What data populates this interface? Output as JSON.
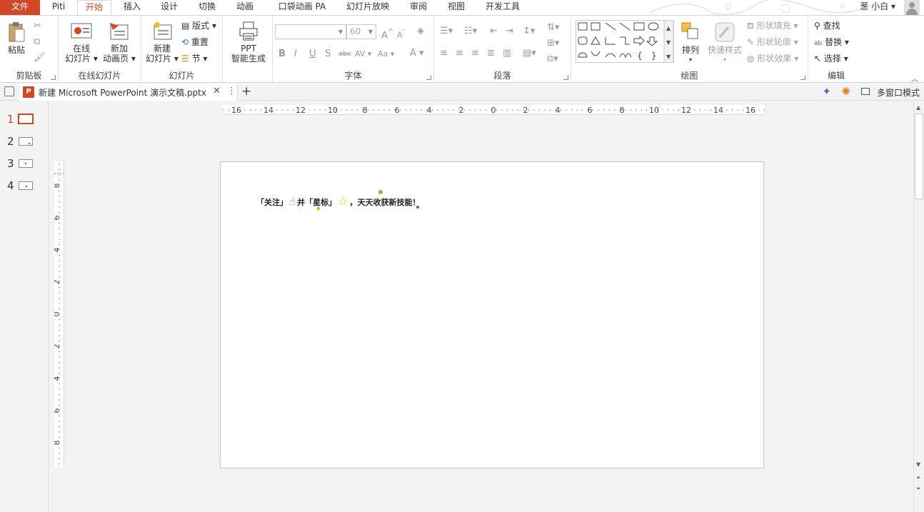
{
  "tabs": {
    "file": "文件",
    "items": [
      "Piti",
      "开始",
      "插入",
      "设计",
      "切换",
      "动画",
      "口袋动画 PA",
      "幻灯片放映",
      "审阅",
      "视图",
      "开发工具"
    ],
    "active_index": 1,
    "user": "葱 小白"
  },
  "ribbon": {
    "clipboard": {
      "label": "剪贴板",
      "paste": "粘贴"
    },
    "online": {
      "label": "在线幻灯片",
      "online1": "在线",
      "online2": "幻灯片",
      "newanim1": "新加",
      "newanim2": "动画页"
    },
    "slides": {
      "label": "幻灯片",
      "new1": "新建",
      "new2": "幻灯片",
      "layout": "版式",
      "reset": "重置",
      "section": "节"
    },
    "ppt": {
      "line1": "PPT",
      "line2": "智能生成"
    },
    "font": {
      "label": "字体",
      "size_value": "60",
      "bold": "B",
      "italic": "I",
      "underline": "U",
      "shadow": "S",
      "strike": "abc",
      "spacing": "AV",
      "case": "Aa",
      "color": "A",
      "grow": "A",
      "shrink": "A"
    },
    "paragraph": {
      "label": "段落"
    },
    "drawing": {
      "label": "绘图",
      "arrange": "排列",
      "quick": "快速样式",
      "fill": "形状填充",
      "outline": "形状轮廓",
      "effect": "形状效果"
    },
    "editing": {
      "label": "编辑",
      "find": "查找",
      "replace": "替换",
      "select": "选择"
    }
  },
  "docbar": {
    "filename": "新建 Microsoft PowerPoint 演示文稿.pptx",
    "multiwindow": "多窗口模式"
  },
  "thumbnails": [
    "1",
    "2",
    "3",
    "4"
  ],
  "active_slide": 1,
  "ruler": {
    "h_labels": [
      "16",
      "14",
      "12",
      "10",
      "8",
      "6",
      "4",
      "2",
      "0",
      "2",
      "4",
      "6",
      "8",
      "10",
      "12",
      "14",
      "16"
    ],
    "v_labels": [
      "8",
      "6",
      "4",
      "2",
      "0",
      "2",
      "4",
      "6",
      "8"
    ]
  },
  "slide": {
    "text_a": "「关注」",
    "text_b": "并「星标」",
    "text_c": "，天天收获新技能！",
    "dot_colors": [
      "#7cc142",
      "#f0a30a",
      "#2b73c6"
    ]
  },
  "colors": {
    "accent": "#d24726"
  }
}
